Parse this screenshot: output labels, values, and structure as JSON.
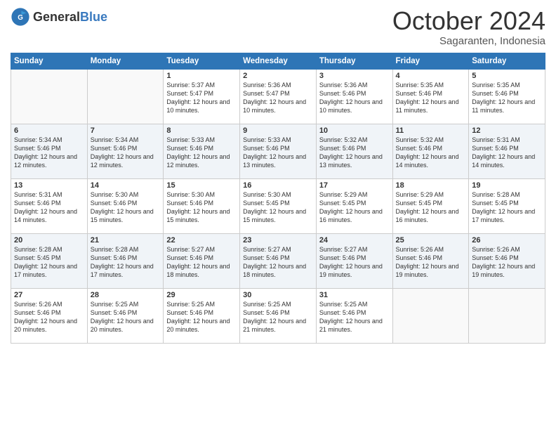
{
  "header": {
    "logo_general": "General",
    "logo_blue": "Blue",
    "month": "October 2024",
    "location": "Sagaranten, Indonesia"
  },
  "weekdays": [
    "Sunday",
    "Monday",
    "Tuesday",
    "Wednesday",
    "Thursday",
    "Friday",
    "Saturday"
  ],
  "weeks": [
    [
      {
        "day": "",
        "sunrise": "",
        "sunset": "",
        "daylight": ""
      },
      {
        "day": "",
        "sunrise": "",
        "sunset": "",
        "daylight": ""
      },
      {
        "day": "1",
        "sunrise": "Sunrise: 5:37 AM",
        "sunset": "Sunset: 5:47 PM",
        "daylight": "Daylight: 12 hours and 10 minutes."
      },
      {
        "day": "2",
        "sunrise": "Sunrise: 5:36 AM",
        "sunset": "Sunset: 5:47 PM",
        "daylight": "Daylight: 12 hours and 10 minutes."
      },
      {
        "day": "3",
        "sunrise": "Sunrise: 5:36 AM",
        "sunset": "Sunset: 5:46 PM",
        "daylight": "Daylight: 12 hours and 10 minutes."
      },
      {
        "day": "4",
        "sunrise": "Sunrise: 5:35 AM",
        "sunset": "Sunset: 5:46 PM",
        "daylight": "Daylight: 12 hours and 11 minutes."
      },
      {
        "day": "5",
        "sunrise": "Sunrise: 5:35 AM",
        "sunset": "Sunset: 5:46 PM",
        "daylight": "Daylight: 12 hours and 11 minutes."
      }
    ],
    [
      {
        "day": "6",
        "sunrise": "Sunrise: 5:34 AM",
        "sunset": "Sunset: 5:46 PM",
        "daylight": "Daylight: 12 hours and 12 minutes."
      },
      {
        "day": "7",
        "sunrise": "Sunrise: 5:34 AM",
        "sunset": "Sunset: 5:46 PM",
        "daylight": "Daylight: 12 hours and 12 minutes."
      },
      {
        "day": "8",
        "sunrise": "Sunrise: 5:33 AM",
        "sunset": "Sunset: 5:46 PM",
        "daylight": "Daylight: 12 hours and 12 minutes."
      },
      {
        "day": "9",
        "sunrise": "Sunrise: 5:33 AM",
        "sunset": "Sunset: 5:46 PM",
        "daylight": "Daylight: 12 hours and 13 minutes."
      },
      {
        "day": "10",
        "sunrise": "Sunrise: 5:32 AM",
        "sunset": "Sunset: 5:46 PM",
        "daylight": "Daylight: 12 hours and 13 minutes."
      },
      {
        "day": "11",
        "sunrise": "Sunrise: 5:32 AM",
        "sunset": "Sunset: 5:46 PM",
        "daylight": "Daylight: 12 hours and 14 minutes."
      },
      {
        "day": "12",
        "sunrise": "Sunrise: 5:31 AM",
        "sunset": "Sunset: 5:46 PM",
        "daylight": "Daylight: 12 hours and 14 minutes."
      }
    ],
    [
      {
        "day": "13",
        "sunrise": "Sunrise: 5:31 AM",
        "sunset": "Sunset: 5:46 PM",
        "daylight": "Daylight: 12 hours and 14 minutes."
      },
      {
        "day": "14",
        "sunrise": "Sunrise: 5:30 AM",
        "sunset": "Sunset: 5:46 PM",
        "daylight": "Daylight: 12 hours and 15 minutes."
      },
      {
        "day": "15",
        "sunrise": "Sunrise: 5:30 AM",
        "sunset": "Sunset: 5:46 PM",
        "daylight": "Daylight: 12 hours and 15 minutes."
      },
      {
        "day": "16",
        "sunrise": "Sunrise: 5:30 AM",
        "sunset": "Sunset: 5:45 PM",
        "daylight": "Daylight: 12 hours and 15 minutes."
      },
      {
        "day": "17",
        "sunrise": "Sunrise: 5:29 AM",
        "sunset": "Sunset: 5:45 PM",
        "daylight": "Daylight: 12 hours and 16 minutes."
      },
      {
        "day": "18",
        "sunrise": "Sunrise: 5:29 AM",
        "sunset": "Sunset: 5:45 PM",
        "daylight": "Daylight: 12 hours and 16 minutes."
      },
      {
        "day": "19",
        "sunrise": "Sunrise: 5:28 AM",
        "sunset": "Sunset: 5:45 PM",
        "daylight": "Daylight: 12 hours and 17 minutes."
      }
    ],
    [
      {
        "day": "20",
        "sunrise": "Sunrise: 5:28 AM",
        "sunset": "Sunset: 5:45 PM",
        "daylight": "Daylight: 12 hours and 17 minutes."
      },
      {
        "day": "21",
        "sunrise": "Sunrise: 5:28 AM",
        "sunset": "Sunset: 5:46 PM",
        "daylight": "Daylight: 12 hours and 17 minutes."
      },
      {
        "day": "22",
        "sunrise": "Sunrise: 5:27 AM",
        "sunset": "Sunset: 5:46 PM",
        "daylight": "Daylight: 12 hours and 18 minutes."
      },
      {
        "day": "23",
        "sunrise": "Sunrise: 5:27 AM",
        "sunset": "Sunset: 5:46 PM",
        "daylight": "Daylight: 12 hours and 18 minutes."
      },
      {
        "day": "24",
        "sunrise": "Sunrise: 5:27 AM",
        "sunset": "Sunset: 5:46 PM",
        "daylight": "Daylight: 12 hours and 19 minutes."
      },
      {
        "day": "25",
        "sunrise": "Sunrise: 5:26 AM",
        "sunset": "Sunset: 5:46 PM",
        "daylight": "Daylight: 12 hours and 19 minutes."
      },
      {
        "day": "26",
        "sunrise": "Sunrise: 5:26 AM",
        "sunset": "Sunset: 5:46 PM",
        "daylight": "Daylight: 12 hours and 19 minutes."
      }
    ],
    [
      {
        "day": "27",
        "sunrise": "Sunrise: 5:26 AM",
        "sunset": "Sunset: 5:46 PM",
        "daylight": "Daylight: 12 hours and 20 minutes."
      },
      {
        "day": "28",
        "sunrise": "Sunrise: 5:25 AM",
        "sunset": "Sunset: 5:46 PM",
        "daylight": "Daylight: 12 hours and 20 minutes."
      },
      {
        "day": "29",
        "sunrise": "Sunrise: 5:25 AM",
        "sunset": "Sunset: 5:46 PM",
        "daylight": "Daylight: 12 hours and 20 minutes."
      },
      {
        "day": "30",
        "sunrise": "Sunrise: 5:25 AM",
        "sunset": "Sunset: 5:46 PM",
        "daylight": "Daylight: 12 hours and 21 minutes."
      },
      {
        "day": "31",
        "sunrise": "Sunrise: 5:25 AM",
        "sunset": "Sunset: 5:46 PM",
        "daylight": "Daylight: 12 hours and 21 minutes."
      },
      {
        "day": "",
        "sunrise": "",
        "sunset": "",
        "daylight": ""
      },
      {
        "day": "",
        "sunrise": "",
        "sunset": "",
        "daylight": ""
      }
    ]
  ]
}
